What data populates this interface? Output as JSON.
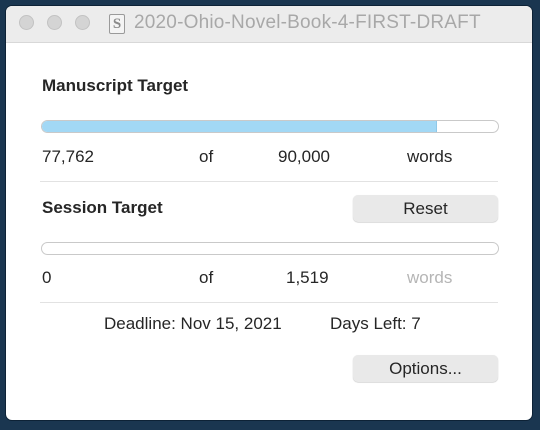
{
  "window": {
    "title": "2020-Ohio-Novel-Book-4-FIRST-DRAFT",
    "doc_icon_glyph": "S"
  },
  "manuscript": {
    "heading": "Manuscript Target",
    "current": "77,762",
    "of": "of",
    "target": "90,000",
    "unit": "words",
    "progress_fraction": 0.864
  },
  "session": {
    "heading": "Session Target",
    "reset_label": "Reset",
    "current": "0",
    "of": "of",
    "target": "1,519",
    "unit": "words",
    "progress_fraction": 0
  },
  "footer": {
    "deadline": "Deadline: Nov 15, 2021",
    "days_left": "Days Left: 7",
    "options_label": "Options..."
  },
  "colors": {
    "progress_fill": "#a2d8f5",
    "desktop_background": "#1a3650"
  },
  "icons": [
    "close-button",
    "minimize-button",
    "zoom-button",
    "scrivener-document-icon"
  ]
}
